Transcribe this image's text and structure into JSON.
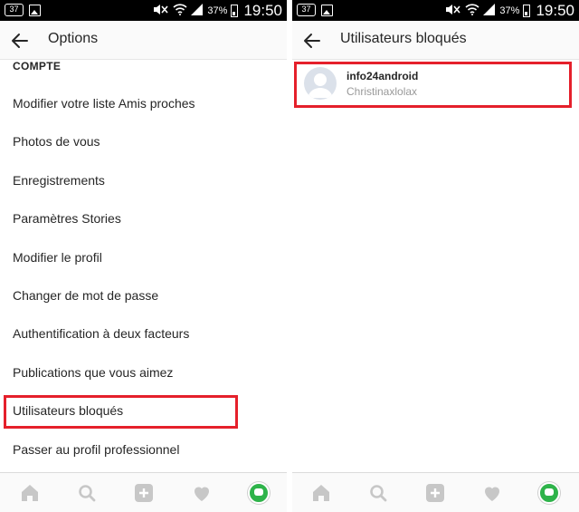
{
  "colors": {
    "highlight": "#e5202b",
    "status_bar": "#000000",
    "app_bar": "#fafafa",
    "text_primary": "#262626",
    "text_secondary": "#999999",
    "nav_icon": "#c7c7c7",
    "profile_avatar": "#2eb34a"
  },
  "status_bar": {
    "notification_count": "37",
    "battery_percent": "37%",
    "time": "19:50",
    "icons": [
      "notification-count-icon",
      "image-icon",
      "mute-icon",
      "wifi-icon",
      "signal-icon",
      "battery-icon"
    ]
  },
  "left_screen": {
    "title": "Options",
    "section_header": "COMPTE",
    "menu_items": [
      "Modifier votre liste Amis proches",
      "Photos de vous",
      "Enregistrements",
      "Paramètres Stories",
      "Modifier le profil",
      "Changer de mot de passe",
      "Authentification à deux facteurs",
      "Publications que vous aimez",
      "Utilisateurs bloqués",
      "Passer au profil professionnel"
    ],
    "highlighted_item": "Utilisateurs bloqués"
  },
  "right_screen": {
    "title": "Utilisateurs bloqués",
    "blocked_users": [
      {
        "username": "info24android",
        "full_name": "Christinaxlolax"
      }
    ]
  },
  "bottom_nav": {
    "items": [
      "home-icon",
      "search-icon",
      "add-post-icon",
      "heart-icon",
      "profile-avatar"
    ]
  }
}
